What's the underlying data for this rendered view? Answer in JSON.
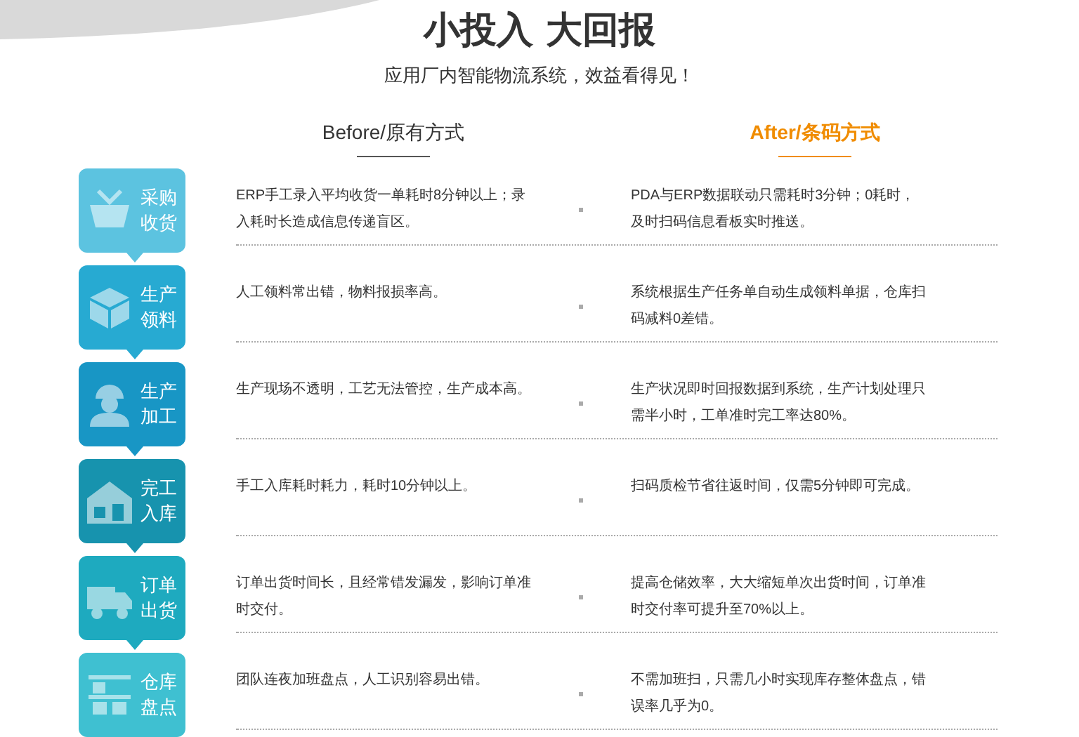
{
  "title": "小投入 大回报",
  "subtitle": "应用厂内智能物流系统，效益看得见！",
  "columns": [
    {
      "label": "Before/原有方式",
      "highlighted": false
    },
    {
      "label": "After/条码方式",
      "highlighted": true
    }
  ],
  "rows": [
    {
      "kind": "basket",
      "label": "采购收货",
      "color": "#5cc3e0",
      "before": "ERP手工录入平均收货一单耗时8分钟以上；录入耗时长造成信息传递盲区。",
      "after": "PDA与ERP数据联动只需耗时3分钟；0耗时，及时扫码信息看板实时推送。"
    },
    {
      "kind": "box",
      "label": "生产领料",
      "color": "#27aad2",
      "before": "人工领料常出错，物料报损率高。",
      "after": "系统根据生产任务单自动生成领料单据，仓库扫码减料0差错。"
    },
    {
      "kind": "worker",
      "label": "生产加工",
      "color": "#1896c5",
      "before": "生产现场不透明，工艺无法管控，生产成本高。",
      "after": "生产状况即时回报数据到系统，生产计划处理只需半小时，工单准时完工率达80%。"
    },
    {
      "kind": "house",
      "label": "完工入库",
      "color": "#1793ae",
      "before": "手工入库耗时耗力，耗时10分钟以上。",
      "after": "扫码质检节省往返时间，仅需5分钟即可完成。"
    },
    {
      "kind": "truck",
      "label": "订单出货",
      "color": "#1eaabf",
      "before": "订单出货时间长，且经常错发漏发，影响订单准时交付。",
      "after": "提高仓储效率，大大缩短单次出货时间，订单准时交付率可提升至70%以上。"
    },
    {
      "kind": "shelf",
      "label": "仓库盘点",
      "color": "#3fc0d1",
      "before": "团队连夜加班盘点，人工识别容易出错。",
      "after": "不需加班扫，只需几小时实现库存整体盘点，错误率几乎为0。"
    }
  ]
}
